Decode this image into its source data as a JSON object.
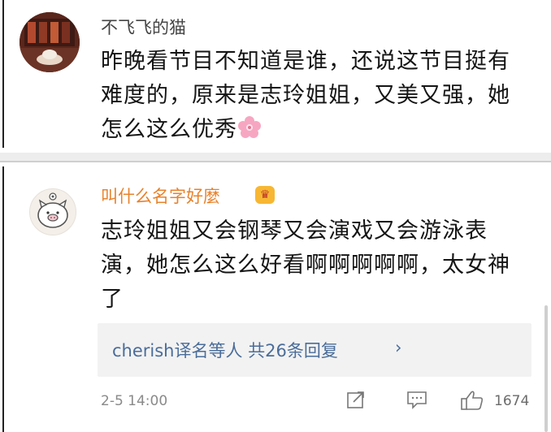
{
  "comments": [
    {
      "username": "不飞飞的猫",
      "text": "昨晚看节目不知道是谁，还说这节目挺有难度的，原来是志玲姐姐，又美又强，她怎么这么优秀"
    },
    {
      "username": "叫什么名字好麼",
      "text": "志玲姐姐又会钢琴又会演戏又会游泳表演，她怎么这么好看啊啊啊啊啊，太女神了",
      "replies_label": "cherish译名等人 共26条回复",
      "replies_chevron": "›",
      "date": "2-5 14:00",
      "likes": "1674"
    }
  ],
  "colors": {
    "username_vip": "#e8822b",
    "username_normal": "#444444",
    "link": "#4a6d9a"
  },
  "icons": [
    "cherry-blossom-emoji",
    "crown-badge-icon",
    "share-icon",
    "comment-icon",
    "like-icon",
    "pig-avatar"
  ]
}
